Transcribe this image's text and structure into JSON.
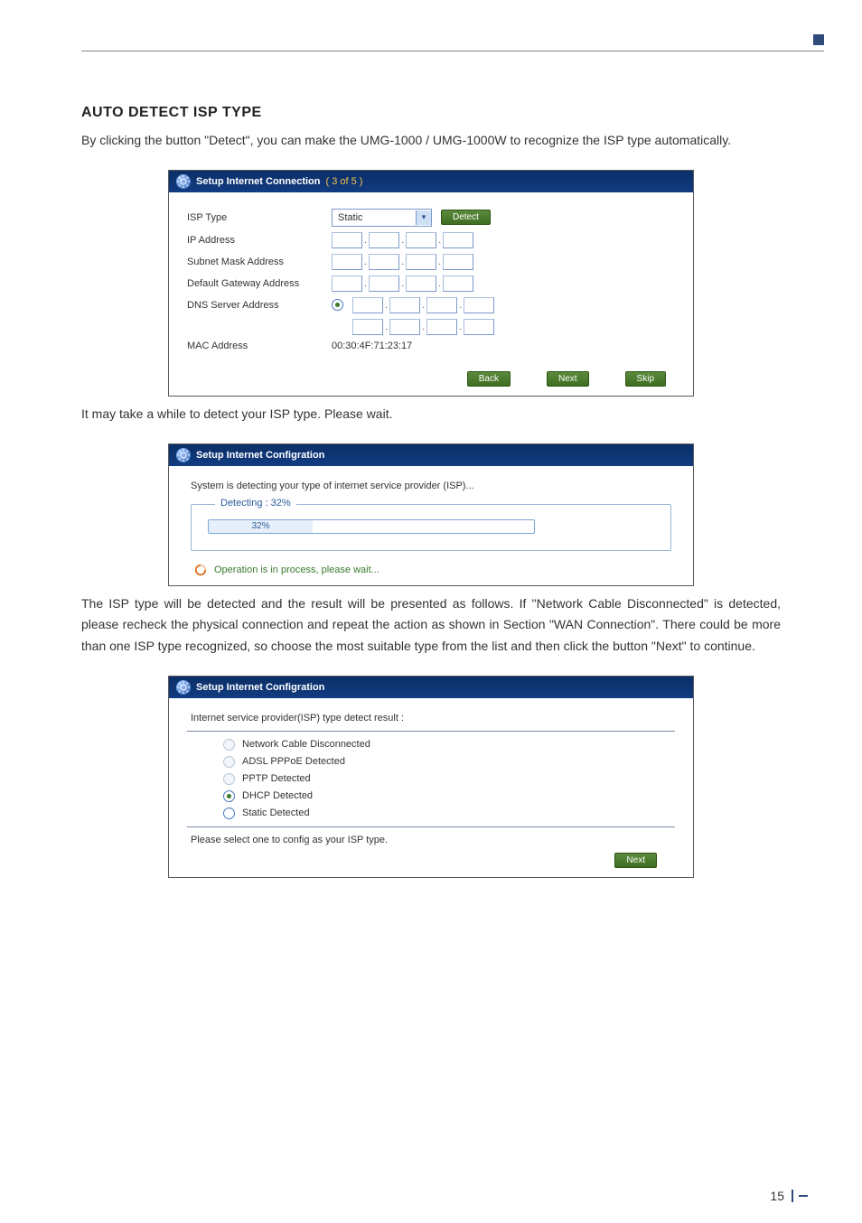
{
  "section": {
    "title": "AUTO DETECT ISP TYPE"
  },
  "paragraphs": {
    "intro": "By clicking the button \"Detect\", you can make the UMG-1000 / UMG-1000W to recognize the ISP type automatically.",
    "wait": "It may take a while to detect your ISP type. Please wait.",
    "result": "The ISP type will be detected and the result will be presented as follows. If \"Network Cable Disconnected\" is detected, please recheck the physical connection and repeat the action as shown in Section \"WAN Connection\". There could be more than one ISP type recognized, so choose the most suitable type from the list and then click the button \"Next\" to continue."
  },
  "panel1": {
    "title": "Setup Internet Connection",
    "step": "( 3 of 5 )",
    "labels": {
      "isp_type": "ISP Type",
      "ip_address": "IP Address",
      "subnet": "Subnet Mask Address",
      "gateway": "Default Gateway Address",
      "dns": "DNS Server Address",
      "mac": "MAC Address"
    },
    "isp_select_value": "Static",
    "detect_btn": "Detect",
    "mac_value": "00:30:4F:71:23:17",
    "buttons": {
      "back": "Back",
      "next": "Next",
      "skip": "Skip"
    }
  },
  "panel2": {
    "title": "Setup Internet Configration",
    "message": "System is detecting your type of internet service provider (ISP)...",
    "progress_legend": "Detecting : 32%",
    "progress_value": "32%",
    "status": "Operation is in process, please wait..."
  },
  "panel3": {
    "title": "Setup Internet Configration",
    "message": "Internet service provider(ISP) type detect result :",
    "options": {
      "cable": "Network Cable Disconnected",
      "pppoe": "ADSL PPPoE Detected",
      "pptp": "PPTP Detected",
      "dhcp": "DHCP Detected",
      "static": "Static Detected"
    },
    "footer": "Please select one to config as your ISP type.",
    "next_btn": "Next"
  },
  "page_number": "15"
}
